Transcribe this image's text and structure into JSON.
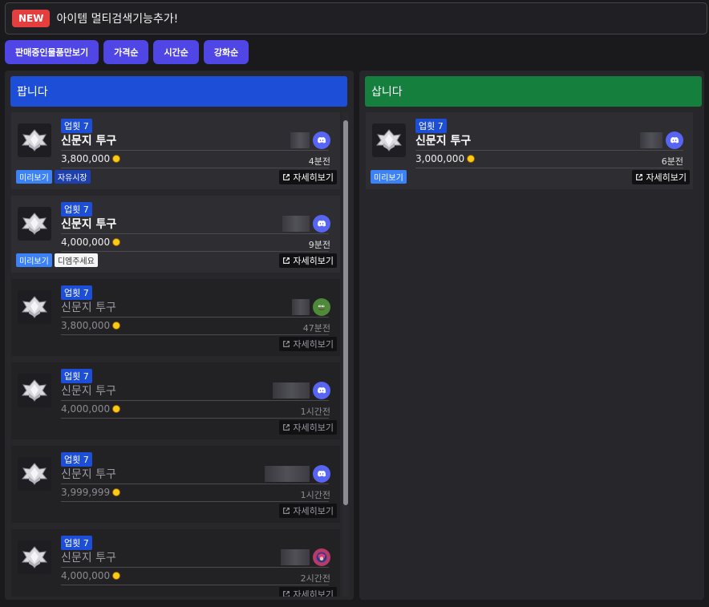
{
  "banner": {
    "badge": "NEW",
    "text": "아이템 멀티검색기능추가!"
  },
  "filters": [
    "판매중인물품만보기",
    "가격순",
    "시간순",
    "강화순"
  ],
  "sell": {
    "title": "팝니다",
    "items": [
      {
        "level": "업횟 7",
        "name": "신문지 투구",
        "price": "3,800,000",
        "time": "4분전",
        "avatar": "discord-avatar",
        "tags": [
          "미리보기",
          "자유시장"
        ],
        "detail": "자세히보기",
        "dim": false
      },
      {
        "level": "업횟 7",
        "name": "신문지 투구",
        "price": "4,000,000",
        "time": "9분전",
        "avatar": "discord-avatar",
        "tags": [
          "미리보기",
          "디엠주세요"
        ],
        "detail": "자세히보기",
        "dim": false
      },
      {
        "level": "업횟 7",
        "name": "신문지 투구",
        "price": "3,800,000",
        "time": "47분전",
        "avatar": "pepe-avatar",
        "tags": [],
        "detail": "자세히보기",
        "dim": true
      },
      {
        "level": "업횟 7",
        "name": "신문지 투구",
        "price": "4,000,000",
        "time": "1시간전",
        "avatar": "discord-avatar",
        "tags": [],
        "detail": "자세히보기",
        "dim": true
      },
      {
        "level": "업횟 7",
        "name": "신문지 투구",
        "price": "3,999,999",
        "time": "1시간전",
        "avatar": "discord-avatar",
        "tags": [],
        "detail": "자세히보기",
        "dim": true
      },
      {
        "level": "업횟 7",
        "name": "신문지 투구",
        "price": "4,000,000",
        "time": "2시간전",
        "avatar": "anime-avatar",
        "tags": [],
        "detail": "자세히보기",
        "dim": true
      }
    ]
  },
  "buy": {
    "title": "삽니다",
    "items": [
      {
        "level": "업횟 7",
        "name": "신문지 투구",
        "price": "3,000,000",
        "time": "6분전",
        "avatar": "discord-avatar",
        "tags": [
          "미리보기"
        ],
        "detail": "자세히보기",
        "dim": false
      }
    ]
  },
  "colors": {
    "sell_header": "#1d4ed8",
    "buy_header": "#15803d",
    "filter_button": "#4f46e5",
    "new_badge": "#e53e3e"
  }
}
